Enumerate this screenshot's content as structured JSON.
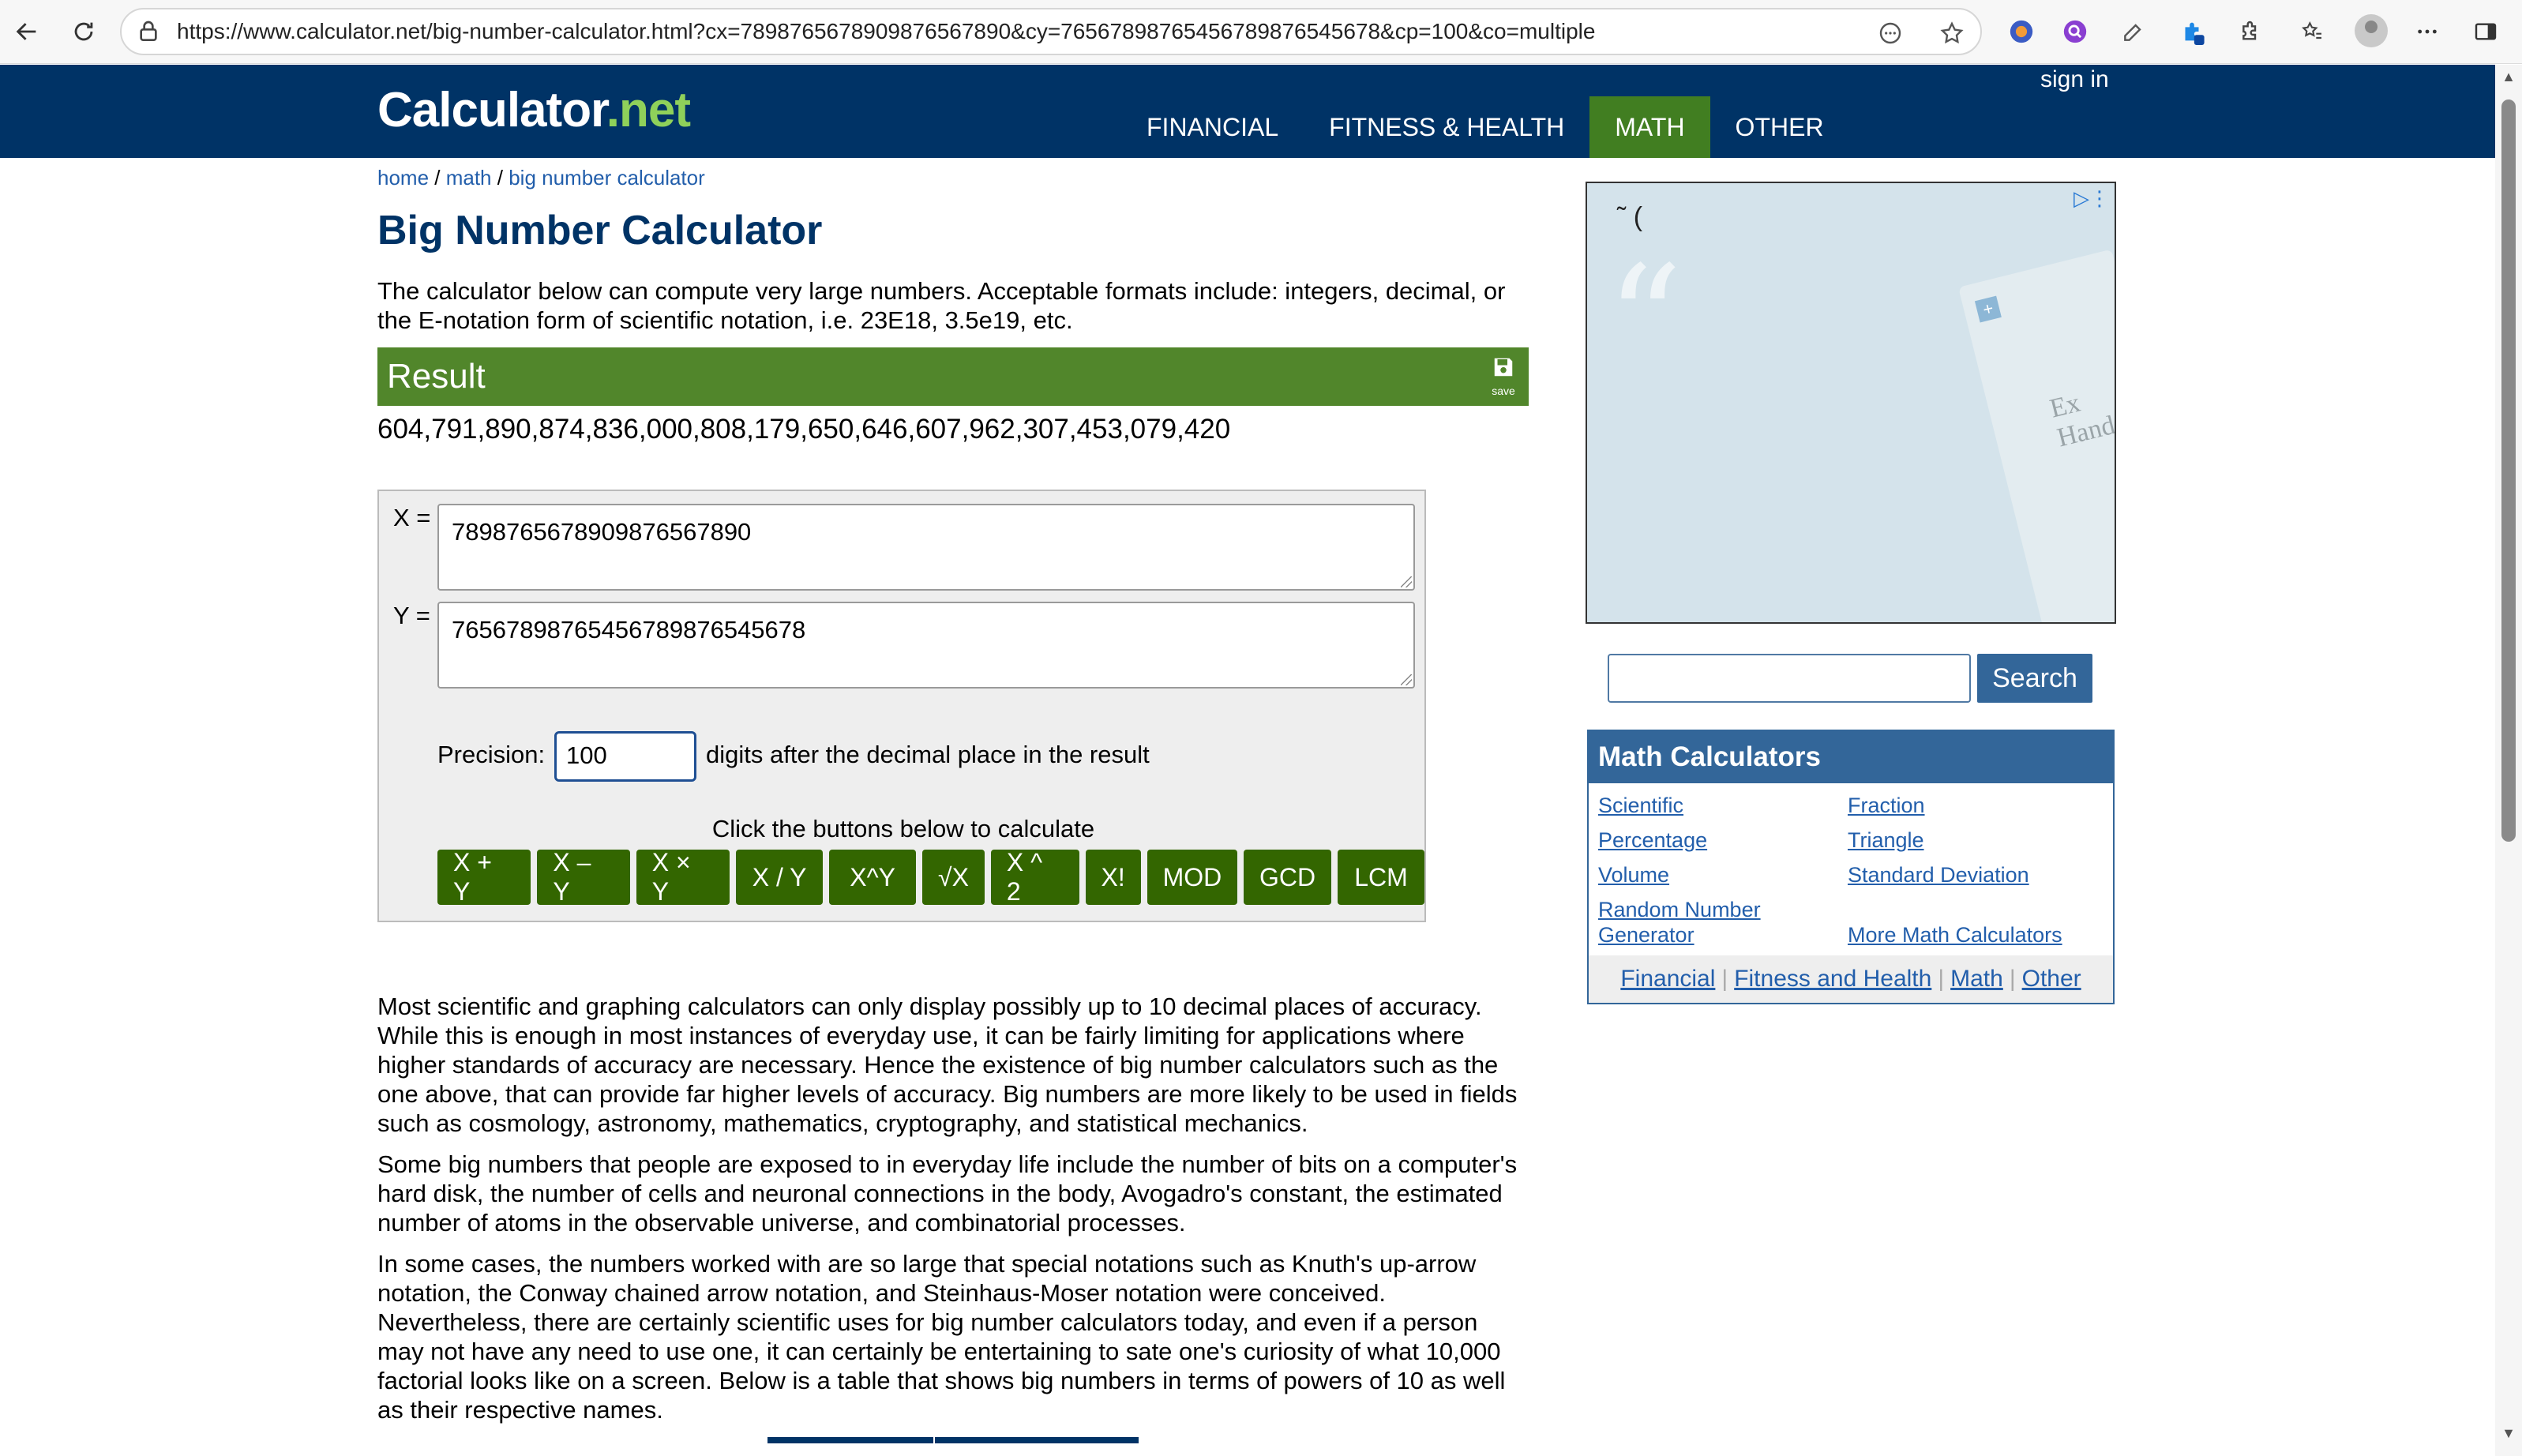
{
  "browser": {
    "url": "https://www.calculator.net/big-number-calculator.html?cx=7898765678909876567890&cy=76567898765456789876545678&cp=100&co=multiple"
  },
  "header": {
    "logo_main": "Calculator",
    "logo_dot": ".",
    "logo_suffix": "net",
    "signin": "sign in",
    "nav": [
      {
        "label": "FINANCIAL"
      },
      {
        "label": "FITNESS & HEALTH"
      },
      {
        "label": "MATH"
      },
      {
        "label": "OTHER"
      }
    ]
  },
  "breadcrumb": {
    "home": "home",
    "sep1": " / ",
    "math": "math",
    "sep2": " / ",
    "current": "big number calculator"
  },
  "page": {
    "title": "Big Number Calculator",
    "intro": "The calculator below can compute very large numbers. Acceptable formats include: integers, decimal, or the E-notation form of scientific notation, i.e. 23E18, 3.5e19, etc."
  },
  "result": {
    "label": "Result",
    "save_label": "save",
    "value": "604,791,890,874,836,000,808,179,650,646,607,962,307,453,079,420"
  },
  "calculator": {
    "x_label": "X =",
    "x_value": "7898765678909876567890",
    "y_label": "Y =",
    "y_value": "76567898765456789876545678",
    "precision_label": "Precision:",
    "precision_value": "100",
    "precision_suffix": "digits after the decimal place in the result",
    "click_label": "Click the buttons below to calculate",
    "buttons": [
      {
        "label": "X + Y"
      },
      {
        "label": "X – Y"
      },
      {
        "label": "X × Y"
      },
      {
        "label": "X / Y"
      },
      {
        "label": "X^Y"
      },
      {
        "label": "√X"
      },
      {
        "label": "X ^ 2"
      },
      {
        "label": "X!"
      },
      {
        "label": "MOD"
      },
      {
        "label": "GCD"
      },
      {
        "label": "LCM"
      }
    ]
  },
  "article": {
    "p1": "Most scientific and graphing calculators can only display possibly up to 10 decimal places of accuracy. While this is enough in most instances of everyday use, it can be fairly limiting for applications where higher standards of accuracy are necessary. Hence the existence of big number calculators such as the one above, that can provide far higher levels of accuracy. Big numbers are more likely to be used in fields such as cosmology, astronomy, mathematics, cryptography, and statistical mechanics.",
    "p2": "Some big numbers that people are exposed to in everyday life include the number of bits on a computer's hard disk, the number of cells and neuronal connections in the body, Avogadro's constant, the estimated number of atoms in the observable universe, and combinatorial processes.",
    "p3": "In some cases, the numbers worked with are so large that special notations such as Knuth's up-arrow notation, the Conway chained arrow notation, and Steinhaus-Moser notation were conceived. Nevertheless, there are certainly scientific uses for big number calculators today, and even if a person may not have any need to use one, it can certainly be entertaining to sate one's curiosity of what 10,000 factorial looks like on a screen. Below is a table that shows big numbers in terms of powers of 10 as well as their respective names."
  },
  "sidebar": {
    "ad_text_1": "Ex",
    "ad_text_2": "Hand",
    "search_button": "Search",
    "math_calculators": {
      "title": "Math Calculators",
      "links": [
        {
          "label": "Scientific"
        },
        {
          "label": "Fraction"
        },
        {
          "label": "Percentage"
        },
        {
          "label": "Triangle"
        },
        {
          "label": "Volume"
        },
        {
          "label": "Standard Deviation"
        },
        {
          "label": "Random Number Generator"
        },
        {
          "label": "More Math Calculators"
        }
      ],
      "footer": [
        {
          "label": "Financial"
        },
        {
          "label": "Fitness and Health"
        },
        {
          "label": "Math"
        },
        {
          "label": "Other"
        }
      ]
    }
  },
  "colors": {
    "header_bg": "#003366",
    "nav_active": "#417e21",
    "result_bar": "#51862b",
    "button_bg": "#336600",
    "sidebar_accent": "#336699",
    "link": "#225eab"
  }
}
